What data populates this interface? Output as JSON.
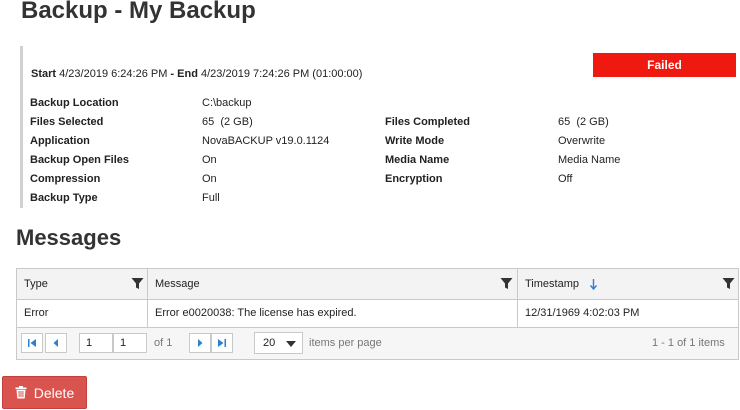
{
  "page": {
    "title": "Backup - My Backup"
  },
  "summary": {
    "start_label": "Start",
    "start_value": "4/23/2019 6:24:26 PM",
    "separator": " - ",
    "end_label": "End",
    "end_value": "4/23/2019 7:24:26 PM (01:00:00)",
    "status": "Failed",
    "status_color": "#f0190f",
    "left": [
      {
        "label": "Backup Location",
        "value": "C:\\backup"
      },
      {
        "label": "Files Selected",
        "value": "65  (2 GB)"
      },
      {
        "label": "Application",
        "value": "NovaBACKUP v19.0.1124"
      },
      {
        "label": "Backup Open Files",
        "value": "On"
      },
      {
        "label": "Compression",
        "value": "On"
      },
      {
        "label": "Backup Type",
        "value": "Full"
      }
    ],
    "right": [
      {
        "label": "Files Completed",
        "value": "65  (2 GB)"
      },
      {
        "label": "Write Mode",
        "value": "Overwrite"
      },
      {
        "label": "Media Name",
        "value": "Media Name"
      },
      {
        "label": "Encryption",
        "value": "Off"
      }
    ]
  },
  "messages": {
    "title": "Messages",
    "columns": [
      "Type",
      "Message",
      "Timestamp"
    ],
    "rows": [
      {
        "type": "Error",
        "message": "Error e0020038: The license has expired.",
        "timestamp": "12/31/1969 4:02:03 PM"
      }
    ],
    "pager": {
      "page_value": "1",
      "page_input": "1",
      "of_text": "of 1",
      "page_size": "20",
      "items_per_page": "items per page",
      "range_text": "1 - 1 of 1 items"
    }
  },
  "actions": {
    "delete_label": "Delete",
    "delete_color": "#d9534f"
  },
  "icons": {
    "filter": "filter-icon",
    "sort": "sort-down-arrow-icon",
    "trash": "trash-icon"
  }
}
